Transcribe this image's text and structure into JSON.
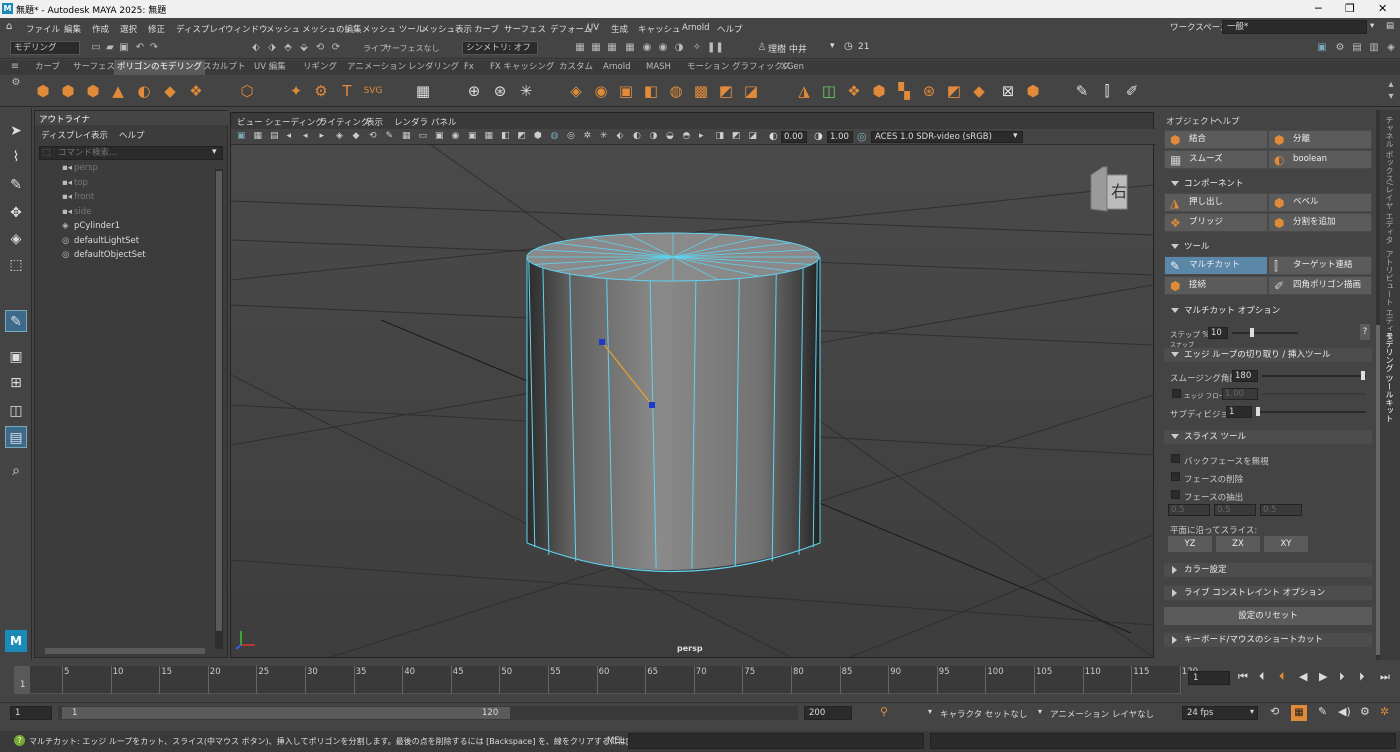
{
  "titlebar": {
    "title": "無題* - Autodesk MAYA 2025: 無題",
    "app_icon": "M"
  },
  "menubar": {
    "items": [
      "ファイル",
      "編集",
      "作成",
      "選択",
      "修正",
      "ディスプレイ",
      "ウィンドウ",
      "メッシュ",
      "メッシュの編集",
      "メッシュ ツール",
      "メッシュ表示",
      "カーブ",
      "サーフェス",
      "デフォーム",
      "UV",
      "生成",
      "キャッシュ",
      "Arnold",
      "ヘルプ"
    ],
    "workspace_label": "ワークスペース:",
    "workspace_value": "一般*"
  },
  "statusline": {
    "mode": "モデリング",
    "live": "ライブ",
    "live_value": "サーフェスなし",
    "symmetry": "シンメトリ: オフ",
    "user": "理樹 中井",
    "notifications": "21"
  },
  "shelf": {
    "tabs": [
      "カーブ",
      "サーフェス",
      "ポリゴンのモデリング",
      "スカルプト",
      "UV 編集",
      "リギング",
      "アニメーション",
      "レンダリング",
      "Fx",
      "FX キャッシング",
      "カスタム",
      "Arnold",
      "MASH",
      "モーション グラフィックス",
      "XGen"
    ],
    "active_tab": "ポリゴンのモデリング"
  },
  "outliner": {
    "title": "アウトライナ",
    "menu": [
      "ディスプレイ",
      "表示",
      "ヘルプ"
    ],
    "search_placeholder": "コマンド検索...",
    "items": [
      {
        "label": "persp",
        "dim": true,
        "icon": "camera-icon"
      },
      {
        "label": "top",
        "dim": true,
        "icon": "camera-icon"
      },
      {
        "label": "front",
        "dim": true,
        "icon": "camera-icon"
      },
      {
        "label": "side",
        "dim": true,
        "icon": "camera-icon"
      },
      {
        "label": "pCylinder1",
        "dim": false,
        "icon": "mesh-icon"
      },
      {
        "label": "defaultLightSet",
        "dim": false,
        "icon": "set-icon"
      },
      {
        "label": "defaultObjectSet",
        "dim": false,
        "icon": "set-icon"
      }
    ]
  },
  "viewport": {
    "menu": [
      "ビュー",
      "シェーディング",
      "ライティング",
      "表示",
      "レンダラ",
      "パネル"
    ],
    "exposure": "0.00",
    "gamma": "1.00",
    "colorspace": "ACES 1.0 SDR-video (sRGB)",
    "camera": "persp",
    "viewcube_label": "右"
  },
  "modeling_toolkit": {
    "menu": [
      "オブジェクト",
      "ヘルプ"
    ],
    "top_buttons": [
      "結合",
      "分離",
      "スムーズ",
      "boolean"
    ],
    "component_header": "コンポーネント",
    "component_buttons": [
      "押し出し",
      "ベベル",
      "ブリッジ",
      "分割を追加"
    ],
    "tools_header": "ツール",
    "tool_buttons": [
      "マルチカット",
      "ターゲット連結",
      "接続",
      "四角ポリゴン描画"
    ],
    "multicut_header": "マルチカット オプション",
    "step_label": "ステップ %を",
    "step_label2": "スナップ",
    "step_value": "10",
    "help_mark": "?",
    "edgeloop_header": "エッジ ループの切り取り / 挿入ツール",
    "smoothing_label": "スムージング角度",
    "smoothing_value": "180",
    "edgeflow_label": "エッジ フロー",
    "edgeflow_value": "1.00",
    "subdiv_label": "サブディビジョン",
    "subdiv_value": "1",
    "slice_header": "スライス ツール",
    "slice_options": [
      "バックフェースを無視",
      "フェースの削除",
      "フェースの抽出"
    ],
    "slice_values": [
      "0.5",
      "0.5",
      "0.5"
    ],
    "slice_plane_label": "平面に沿ってスライス:",
    "slice_planes": [
      "YZ",
      "ZX",
      "XY"
    ],
    "color_header": "カラー設定",
    "constraint_header": "ライブ コンストレイント オプション",
    "reset_button": "設定のリセット",
    "shortcut_header": "キーボード/マウスのショートカット"
  },
  "side_tabs": [
    "チャネル ボックス/レイヤ エディタ",
    "アトリビュート エディタ",
    "モデリング ツールキット"
  ],
  "timeline": {
    "ticks": [
      "5",
      "10",
      "15",
      "20",
      "25",
      "30",
      "35",
      "40",
      "45",
      "50",
      "55",
      "60",
      "65",
      "70",
      "75",
      "80",
      "85",
      "90",
      "95",
      "100",
      "105",
      "110",
      "115",
      "120"
    ],
    "current_frame_marker": "1",
    "current_frame": "1"
  },
  "range": {
    "start": "1",
    "inner_start": "1",
    "inner_end": "120",
    "end": "200",
    "character_set": "キャラクタ セットなし",
    "anim_layer": "アニメーション レイヤなし",
    "fps": "24 fps"
  },
  "help_line": {
    "text": "マルチカット: エッジ ループをカット、スライス(中マウス ボタン)、挿入してポリゴンを分割します。最後の点を削除するには [Backspace] を、線をクリアするには[Esc] を押します。",
    "mel_label": "MEL"
  },
  "colors": {
    "accent": "#5b87a8",
    "selection_wire": "#5fd3f0",
    "shelf_icon": "#e08a3a"
  }
}
